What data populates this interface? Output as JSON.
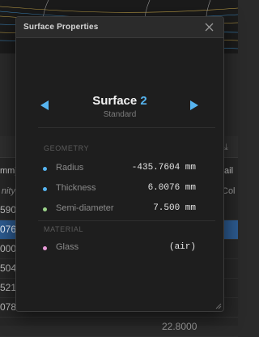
{
  "dialog": {
    "title": "Surface Properties",
    "surface_label": "Surface",
    "surface_number": "2",
    "surface_type": "Standard"
  },
  "sections": {
    "geometry": "GEOMETRY",
    "material": "MATERIAL"
  },
  "properties": [
    {
      "label": "Radius",
      "value": "-435.7604 mm",
      "dot_color": "#56b4f0"
    },
    {
      "label": "Thickness",
      "value": "6.0076 mm",
      "dot_color": "#56b4f0"
    },
    {
      "label": "Semi-diameter",
      "value": "7.500 mm",
      "dot_color": "#9bd38a"
    },
    {
      "label": "Glass",
      "value": "(air)",
      "dot_color": "#e89ad8"
    }
  ],
  "background_table": {
    "header_left": "mm)",
    "header_right": "tail",
    "subheader_left": "nity",
    "subheader_right": "Col",
    "rows_left": [
      "590",
      "076",
      "000",
      "504",
      "521",
      "078",
      ""
    ],
    "rows_right": [
      "",
      "",
      "",
      "",
      "",
      "",
      ""
    ],
    "bottom_partial": "22.8000"
  },
  "colors": {
    "accent": "#56b4f0",
    "selected_row": "#2c5a8f"
  }
}
